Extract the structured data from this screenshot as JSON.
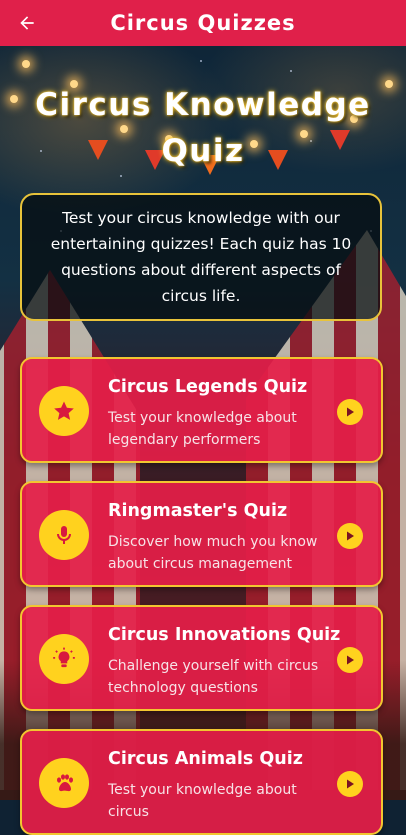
{
  "appbar": {
    "title": "Circus Quizzes",
    "back_icon": "arrow-left-icon"
  },
  "hero": {
    "title": "Circus Knowledge Quiz"
  },
  "intro": {
    "text": "Test your circus knowledge with our entertaining quizzes! Each quiz has 10 questions about different aspects of circus life."
  },
  "quizzes": [
    {
      "title": "Circus Legends Quiz",
      "description": "Test your knowledge about legendary performers",
      "icon": "star-icon"
    },
    {
      "title": "Ringmaster's Quiz",
      "description": "Discover how much you know about circus management",
      "icon": "microphone-icon"
    },
    {
      "title": "Circus Innovations Quiz",
      "description": "Challenge yourself with circus technology questions",
      "icon": "lightbulb-icon"
    },
    {
      "title": "Circus Animals Quiz",
      "description": "Test your knowledge about circus",
      "icon": "paw-icon"
    }
  ],
  "colors": {
    "appbar": "#e0204a",
    "card": "#e41e48",
    "accent": "#ffd21e",
    "border": "#f2c630"
  }
}
